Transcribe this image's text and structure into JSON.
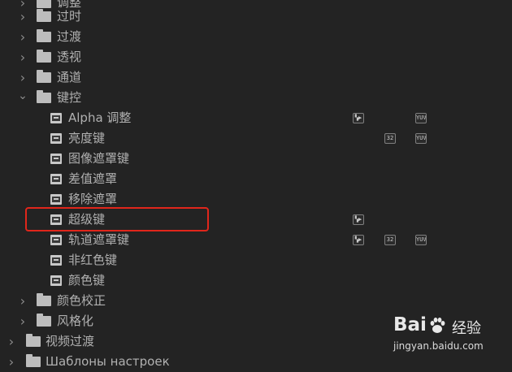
{
  "tree": {
    "rows": [
      {
        "label": "调整",
        "type": "folder",
        "expanded": false
      },
      {
        "label": "过时",
        "type": "folder",
        "expanded": false
      },
      {
        "label": "过渡",
        "type": "folder",
        "expanded": false
      },
      {
        "label": "透视",
        "type": "folder",
        "expanded": false
      },
      {
        "label": "通道",
        "type": "folder",
        "expanded": false
      },
      {
        "label": "键控",
        "type": "folder",
        "expanded": true
      },
      {
        "label": "Alpha 调整",
        "type": "effect",
        "badges": [
          "accelerated",
          "yuv"
        ]
      },
      {
        "label": "亮度键",
        "type": "effect",
        "badges": [
          "32bit",
          "yuv"
        ]
      },
      {
        "label": "图像遮罩键",
        "type": "effect",
        "badges": []
      },
      {
        "label": "差值遮罩",
        "type": "effect",
        "badges": []
      },
      {
        "label": "移除遮罩",
        "type": "effect",
        "badges": []
      },
      {
        "label": "超级键",
        "type": "effect",
        "badges": [
          "accelerated"
        ],
        "highlighted": true
      },
      {
        "label": "轨道遮罩键",
        "type": "effect",
        "badges": [
          "accelerated",
          "32bit",
          "yuv"
        ]
      },
      {
        "label": "非红色键",
        "type": "effect",
        "badges": []
      },
      {
        "label": "颜色键",
        "type": "effect",
        "badges": []
      },
      {
        "label": "颜色校正",
        "type": "folder",
        "expanded": false
      },
      {
        "label": "风格化",
        "type": "folder",
        "expanded": false
      },
      {
        "label": "视频过渡",
        "type": "bin",
        "expanded": false
      },
      {
        "label": "Шаблоны настроек",
        "type": "presets",
        "expanded": false
      }
    ]
  },
  "badges": {
    "accelerated_glyph": "▚▶",
    "32bit_glyph": "32",
    "yuv_glyph": "YUV"
  },
  "watermark": {
    "brand": "Bai",
    "brand_icon": "paw-icon",
    "name": "经验",
    "url": "jingyan.baidu.com"
  },
  "colors": {
    "background": "#232323",
    "text": "#b0b0b0",
    "highlight": "#e0261b"
  }
}
